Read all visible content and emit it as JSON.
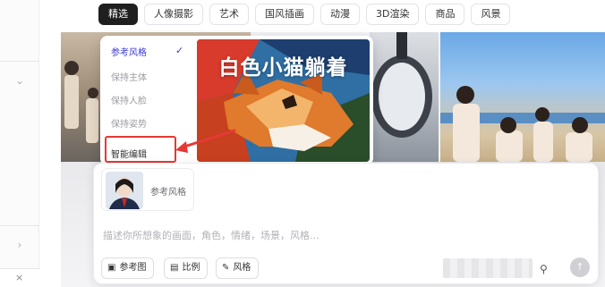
{
  "tabs": [
    {
      "label": "精选"
    },
    {
      "label": "人像摄影"
    },
    {
      "label": "艺术"
    },
    {
      "label": "国风插画"
    },
    {
      "label": "动漫"
    },
    {
      "label": "3D渲染"
    },
    {
      "label": "商品"
    },
    {
      "label": "风景"
    }
  ],
  "menu": {
    "items": [
      {
        "label": "参考风格"
      },
      {
        "label": "保持主体"
      },
      {
        "label": "保持人脸"
      },
      {
        "label": "保持姿势"
      },
      {
        "label": "智能编辑"
      }
    ],
    "selected": "参考风格",
    "highlighted": "智能编辑",
    "preview_caption": "白色小猫躺着"
  },
  "composer": {
    "reference_label": "参考风格",
    "prompt_placeholder": "描述你所想象的画面，角色，情绪，场景，风格...",
    "toolbar": [
      {
        "label": "参考图",
        "icon": "image-icon"
      },
      {
        "label": "比例",
        "icon": "aspect-ratio-icon"
      },
      {
        "label": "风格",
        "icon": "brush-icon"
      }
    ]
  },
  "colors": {
    "accent": "#3a3ad6",
    "highlight_red": "#e53935",
    "active_tab": "#1f1f1f"
  }
}
